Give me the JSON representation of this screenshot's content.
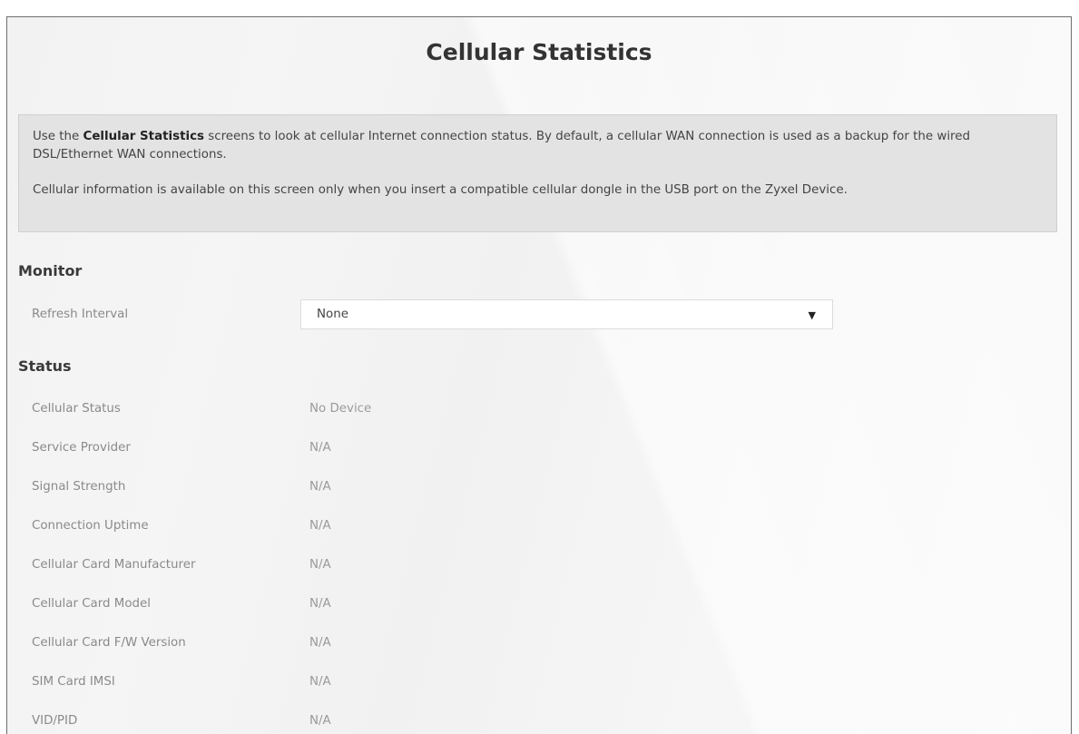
{
  "page": {
    "title": "Cellular Statistics"
  },
  "info": {
    "line1_prefix": "Use the ",
    "line1_bold": "Cellular Statistics",
    "line1_rest": " screens to look at cellular Internet connection status. By default, a cellular WAN connection is used as a backup for the wired DSL/Ethernet WAN connections.",
    "line2": "Cellular information is available on this screen only when you insert a compatible cellular dongle in the USB port on the Zyxel Device."
  },
  "monitor": {
    "heading": "Monitor",
    "refresh_label": "Refresh Interval",
    "refresh_value": "None",
    "refresh_icon": "caret-down-icon"
  },
  "status": {
    "heading": "Status",
    "rows": [
      {
        "label": "Cellular Status",
        "value": "No Device"
      },
      {
        "label": "Service Provider",
        "value": "N/A"
      },
      {
        "label": "Signal Strength",
        "value": "N/A"
      },
      {
        "label": "Connection Uptime",
        "value": "N/A"
      },
      {
        "label": "Cellular Card Manufacturer",
        "value": "N/A"
      },
      {
        "label": "Cellular Card Model",
        "value": "N/A"
      },
      {
        "label": "Cellular Card F/W Version",
        "value": "N/A"
      },
      {
        "label": "SIM Card IMSI",
        "value": "N/A"
      },
      {
        "label": "VID/PID",
        "value": "N/A"
      }
    ]
  }
}
